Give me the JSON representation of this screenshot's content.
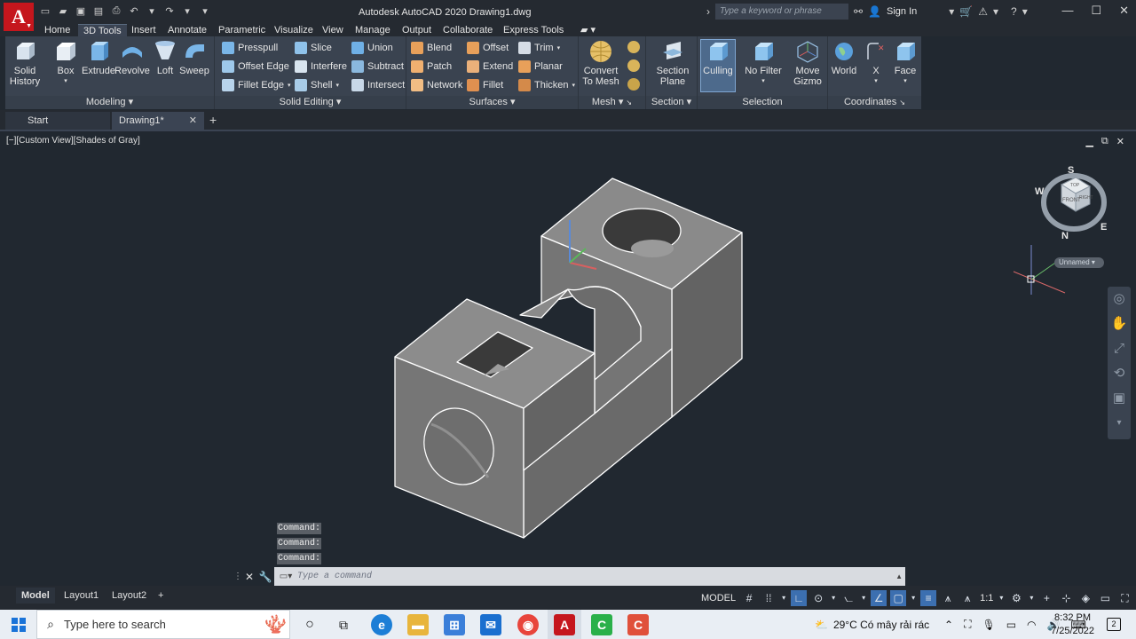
{
  "title_bar": {
    "app_logo": "A",
    "title": "Autodesk AutoCAD 2020    Drawing1.dwg",
    "search_placeholder": "Type a keyword or phrase",
    "sign_in": "Sign In"
  },
  "ribbon_tabs": [
    "Home",
    "3D Tools",
    "Insert",
    "Annotate",
    "Parametric",
    "Visualize",
    "View",
    "Manage",
    "Output",
    "Collaborate",
    "Express Tools"
  ],
  "active_ribbon_tab": "3D Tools",
  "panels": {
    "modeling": {
      "title": "Modeling",
      "solid_history": "Solid\nHistory",
      "box": "Box",
      "extrude": "Extrude",
      "revolve": "Revolve",
      "loft": "Loft",
      "sweep": "Sweep"
    },
    "solid_editing": {
      "title": "Solid Editing",
      "presspull": "Presspull",
      "offset_edge": "Offset Edge",
      "fillet_edge": "Fillet Edge",
      "slice": "Slice",
      "interfere": "Interfere",
      "shell": "Shell",
      "union": "Union",
      "subtract": "Subtract",
      "intersect": "Intersect"
    },
    "surfaces": {
      "title": "Surfaces",
      "blend": "Blend",
      "patch": "Patch",
      "network": "Network",
      "offset": "Offset",
      "extend": "Extend",
      "fillet": "Fillet",
      "trim": "Trim",
      "planar": "Planar",
      "thicken": "Thicken"
    },
    "mesh": {
      "title": "Mesh",
      "convert": "Convert\nTo Mesh"
    },
    "section": {
      "title": "Section",
      "section_plane": "Section\nPlane"
    },
    "selection": {
      "title": "Selection",
      "culling": "Culling",
      "no_filter": "No Filter",
      "move_gizmo": "Move\nGizmo"
    },
    "coordinates": {
      "title": "Coordinates",
      "world": "World",
      "x": "X",
      "face": "Face"
    }
  },
  "file_tabs": {
    "start": "Start",
    "drawing": "Drawing1*"
  },
  "viewport": {
    "label": "[−][Custom View][Shades of Gray]",
    "viewcube": {
      "top": "TOP",
      "front": "FRONT",
      "right": "RIGHT",
      "n": "N",
      "s": "S",
      "e": "E",
      "w": "W"
    },
    "ucs_name": "Unnamed"
  },
  "command": {
    "history": [
      "Command:",
      "Command:",
      "Command:"
    ],
    "placeholder": "Type a command"
  },
  "layout_tabs": [
    "Model",
    "Layout1",
    "Layout2"
  ],
  "status": {
    "model": "MODEL",
    "scale": "1:1"
  },
  "taskbar": {
    "search_placeholder": "Type here to search",
    "weather": "29°C  Có mây rải rác",
    "time": "8:32 PM",
    "date": "7/25/2022",
    "notifications": "2"
  },
  "colors": {
    "accent": "#c5161d",
    "viewport_bg": "#212830",
    "ribbon_bg": "#3a4350",
    "solid_fill": "#707070"
  }
}
